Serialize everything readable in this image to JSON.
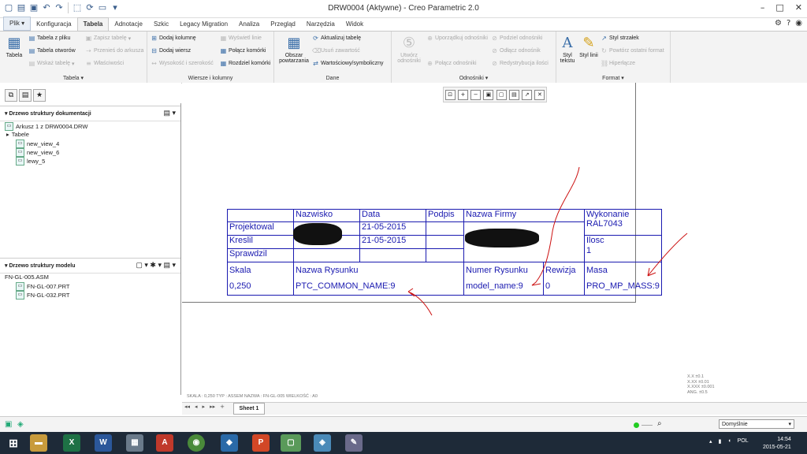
{
  "window": {
    "title": "DRW0004 (Aktywne) - Creo Parametric 2.0",
    "quick_access_icons": [
      "new-icon",
      "open-icon",
      "save-icon",
      "undo-icon",
      "redo-icon",
      "select-icon",
      "regenerate-icon",
      "windows-icon",
      "more-icon"
    ]
  },
  "tabs": [
    "Plik",
    "Konfiguracja",
    "Tabela",
    "Adnotacje",
    "Szkic",
    "Legacy Migration",
    "Analiza",
    "Przegląd",
    "Narzędzia",
    "Widok"
  ],
  "active_tab": "Tabela",
  "ribbon": {
    "groups": {
      "tabela": {
        "label": "Tabela",
        "big": "Tabela",
        "items": [
          "Tabela z pliku",
          "Tabela otworów",
          "Wskaż tabelę",
          "Zapisz tabelę",
          "Przenieś do arkusza",
          "Właściwości"
        ]
      },
      "wiersze": {
        "label": "Wiersze i kolumny",
        "items": [
          "Dodaj kolumnę",
          "Dodaj wiersz",
          "Wysokość i szerokość",
          "Wyświetl linie",
          "Połącz komórki",
          "Rozdziel komórki"
        ]
      },
      "dane": {
        "label": "Dane",
        "big": "Obszar powtarzania",
        "items": [
          "Aktualizuj tabelę",
          "Usuń zawartość",
          "Wartościowy/symboliczny"
        ]
      },
      "odnosniki": {
        "label": "Odnośniki",
        "big": "Utwórz odnośniki",
        "items": [
          "Uporządkuj odnośniki",
          "Połącz odnośniki",
          "Podziel odnośniki",
          "Odłącz odnośnik",
          "Redystrybucja ilości"
        ]
      },
      "format": {
        "label": "Format",
        "big1": "Styl tekstu",
        "big2": "Styl linii",
        "items": [
          "Styl strzałek",
          "Powtórz ostatni format",
          "Hiperłącze"
        ]
      }
    }
  },
  "left_panel": {
    "doc_tree_title": "Drzewo struktury dokumentacji",
    "doc_tree": [
      "Arkusz 1 z DRW0004.DRW",
      "Tabele",
      "new_view_4",
      "new_view_6",
      "lewy_5"
    ],
    "model_tree_title": "Drzewo struktury modelu",
    "model_tree": [
      "FN-GL-005.ASM",
      "FN-GL-007.PRT",
      "FN-GL-032.PRT"
    ]
  },
  "title_block": {
    "headers": {
      "nazwisko": "Nazwisko",
      "data": "Data",
      "podpis": "Podpis",
      "nazwa_firmy": "Nazwa Firmy",
      "wykonanie": "Wykonanie"
    },
    "wykonanie_value": "RAL7043",
    "rows": [
      {
        "label": "Projektowal",
        "date": "21-05-2015"
      },
      {
        "label": "Kreslil",
        "date": "21-05-2015"
      },
      {
        "label": "Sprawdzil",
        "date": ""
      }
    ],
    "ilosc_label": "Ilosc",
    "ilosc_value": "1",
    "skala_label": "Skala",
    "skala_value": "0,250",
    "nazwa_rysunku_label": "Nazwa Rysunku",
    "nazwa_rysunku_value": "PTC_COMMON_NAME:9",
    "numer_rysunku_label": "Numer Rysunku",
    "numer_rysunku_value": "model_name:9",
    "rewizja_label": "Rewizja",
    "rewizja_value": "0",
    "masa_label": "Masa",
    "masa_value": "PRO_MP_MASS:9"
  },
  "sheet_status": "SKALA : 0,250      TYP : ASSEM      NAZWA : FN-GL-005      WIELKOŚĆ : A0",
  "tolerances": [
    "X.X  ±0.1",
    "X.XX  ±0.01",
    "X.XXX  ±0.001",
    "ANG.  ±0.5"
  ],
  "sheet_tab": "Sheet 1",
  "selection_filter": "Domyślnie",
  "taskbar": {
    "language": "POL",
    "time": "14:54",
    "date": "2015-05-21"
  },
  "colors": {
    "table_text": "#1a1ab0",
    "annotation_red": "#cc1111",
    "taskbar": "#1e2a38"
  }
}
